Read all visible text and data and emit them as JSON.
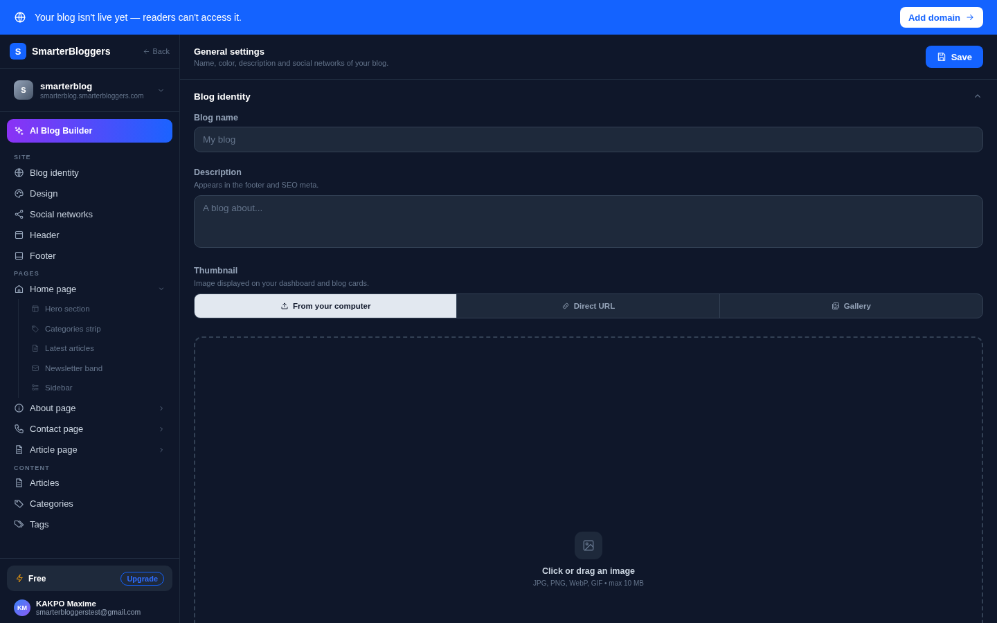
{
  "banner": {
    "message": "Your blog isn't live yet — readers can't access it.",
    "button": "Add domain"
  },
  "sidebar": {
    "brand": {
      "logo": "S",
      "name": "SmarterBloggers",
      "back": "Back"
    },
    "blog": {
      "avatar": "S",
      "name": "smarterblog",
      "domain": "smarterblog.smarterbloggers.com"
    },
    "ai_builder": "AI Blog Builder",
    "sections": [
      {
        "heading": "SITE",
        "items": [
          {
            "kind": "link",
            "label": "Blog identity"
          },
          {
            "kind": "link",
            "label": "Design"
          },
          {
            "kind": "link",
            "label": "Social networks"
          },
          {
            "kind": "link",
            "label": "Header"
          },
          {
            "kind": "link",
            "label": "Footer"
          }
        ]
      },
      {
        "heading": "PAGES",
        "items": [
          {
            "kind": "group",
            "label": "Home page",
            "expanded": true,
            "children": [
              {
                "label": "Hero section"
              },
              {
                "label": "Categories strip"
              },
              {
                "label": "Latest articles"
              },
              {
                "label": "Newsletter band"
              },
              {
                "label": "Sidebar"
              }
            ]
          },
          {
            "kind": "group",
            "label": "About page",
            "expanded": false
          },
          {
            "kind": "group",
            "label": "Contact page",
            "expanded": false
          },
          {
            "kind": "group",
            "label": "Article page",
            "expanded": false
          }
        ]
      },
      {
        "heading": "CONTENT",
        "items": [
          {
            "kind": "link",
            "label": "Articles"
          },
          {
            "kind": "link",
            "label": "Categories"
          },
          {
            "kind": "link",
            "label": "Tags"
          }
        ]
      }
    ],
    "plan": {
      "name": "Free",
      "upgrade": "Upgrade"
    },
    "user": {
      "initials": "KM",
      "name": "KAKPO Maxime",
      "email": "smarterbloggerstest@gmail.com"
    }
  },
  "main": {
    "header": {
      "title": "General settings",
      "subtitle": "Name, color, description and social networks of your blog.",
      "save": "Save"
    },
    "section": {
      "title": "Blog identity",
      "expanded": true
    },
    "blog_name": {
      "label": "Blog name",
      "placeholder": "My blog"
    },
    "description": {
      "label": "Description",
      "hint": "Appears in the footer and SEO meta.",
      "placeholder": "A blog about..."
    },
    "thumbnail": {
      "label": "Thumbnail",
      "hint": "Image displayed on your dashboard and blog cards.",
      "tabs": [
        {
          "label": "From your computer",
          "selected": true
        },
        {
          "label": "Direct URL",
          "selected": false
        },
        {
          "label": "Gallery",
          "selected": false
        }
      ],
      "dropzone": {
        "title": "Click or drag an image",
        "hint": "JPG, PNG, WebP, GIF • max 10 MB"
      }
    }
  }
}
